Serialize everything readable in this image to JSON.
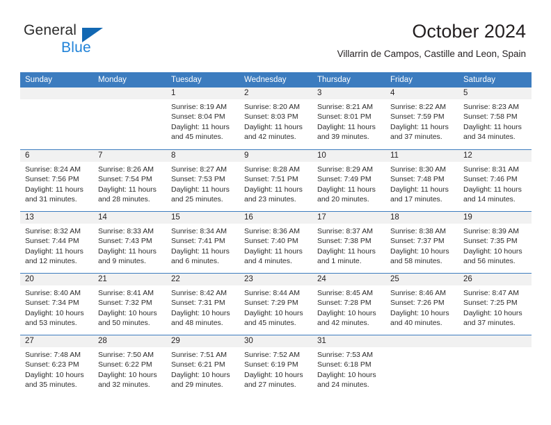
{
  "logo": {
    "word1": "General",
    "word2": "Blue",
    "triangle_color": "#1268b3",
    "blue_text_color": "#1f82d8"
  },
  "header": {
    "title": "October 2024",
    "location": "Villarrin de Campos, Castille and Leon, Spain"
  },
  "theme": {
    "header_band": "#3c7cbf",
    "day_number_band": "#f1f1f1",
    "text": "#231f20"
  },
  "weekdays": [
    "Sunday",
    "Monday",
    "Tuesday",
    "Wednesday",
    "Thursday",
    "Friday",
    "Saturday"
  ],
  "labels": {
    "sunrise_prefix": "Sunrise:",
    "sunset_prefix": "Sunset:",
    "daylight_prefix": "Daylight:"
  },
  "weeks": [
    [
      {
        "day": "",
        "sunrise": "",
        "sunset": "",
        "daylight": ""
      },
      {
        "day": "",
        "sunrise": "",
        "sunset": "",
        "daylight": ""
      },
      {
        "day": "1",
        "sunrise": "Sunrise: 8:19 AM",
        "sunset": "Sunset: 8:04 PM",
        "daylight": "Daylight: 11 hours and 45 minutes."
      },
      {
        "day": "2",
        "sunrise": "Sunrise: 8:20 AM",
        "sunset": "Sunset: 8:03 PM",
        "daylight": "Daylight: 11 hours and 42 minutes."
      },
      {
        "day": "3",
        "sunrise": "Sunrise: 8:21 AM",
        "sunset": "Sunset: 8:01 PM",
        "daylight": "Daylight: 11 hours and 39 minutes."
      },
      {
        "day": "4",
        "sunrise": "Sunrise: 8:22 AM",
        "sunset": "Sunset: 7:59 PM",
        "daylight": "Daylight: 11 hours and 37 minutes."
      },
      {
        "day": "5",
        "sunrise": "Sunrise: 8:23 AM",
        "sunset": "Sunset: 7:58 PM",
        "daylight": "Daylight: 11 hours and 34 minutes."
      }
    ],
    [
      {
        "day": "6",
        "sunrise": "Sunrise: 8:24 AM",
        "sunset": "Sunset: 7:56 PM",
        "daylight": "Daylight: 11 hours and 31 minutes."
      },
      {
        "day": "7",
        "sunrise": "Sunrise: 8:26 AM",
        "sunset": "Sunset: 7:54 PM",
        "daylight": "Daylight: 11 hours and 28 minutes."
      },
      {
        "day": "8",
        "sunrise": "Sunrise: 8:27 AM",
        "sunset": "Sunset: 7:53 PM",
        "daylight": "Daylight: 11 hours and 25 minutes."
      },
      {
        "day": "9",
        "sunrise": "Sunrise: 8:28 AM",
        "sunset": "Sunset: 7:51 PM",
        "daylight": "Daylight: 11 hours and 23 minutes."
      },
      {
        "day": "10",
        "sunrise": "Sunrise: 8:29 AM",
        "sunset": "Sunset: 7:49 PM",
        "daylight": "Daylight: 11 hours and 20 minutes."
      },
      {
        "day": "11",
        "sunrise": "Sunrise: 8:30 AM",
        "sunset": "Sunset: 7:48 PM",
        "daylight": "Daylight: 11 hours and 17 minutes."
      },
      {
        "day": "12",
        "sunrise": "Sunrise: 8:31 AM",
        "sunset": "Sunset: 7:46 PM",
        "daylight": "Daylight: 11 hours and 14 minutes."
      }
    ],
    [
      {
        "day": "13",
        "sunrise": "Sunrise: 8:32 AM",
        "sunset": "Sunset: 7:44 PM",
        "daylight": "Daylight: 11 hours and 12 minutes."
      },
      {
        "day": "14",
        "sunrise": "Sunrise: 8:33 AM",
        "sunset": "Sunset: 7:43 PM",
        "daylight": "Daylight: 11 hours and 9 minutes."
      },
      {
        "day": "15",
        "sunrise": "Sunrise: 8:34 AM",
        "sunset": "Sunset: 7:41 PM",
        "daylight": "Daylight: 11 hours and 6 minutes."
      },
      {
        "day": "16",
        "sunrise": "Sunrise: 8:36 AM",
        "sunset": "Sunset: 7:40 PM",
        "daylight": "Daylight: 11 hours and 4 minutes."
      },
      {
        "day": "17",
        "sunrise": "Sunrise: 8:37 AM",
        "sunset": "Sunset: 7:38 PM",
        "daylight": "Daylight: 11 hours and 1 minute."
      },
      {
        "day": "18",
        "sunrise": "Sunrise: 8:38 AM",
        "sunset": "Sunset: 7:37 PM",
        "daylight": "Daylight: 10 hours and 58 minutes."
      },
      {
        "day": "19",
        "sunrise": "Sunrise: 8:39 AM",
        "sunset": "Sunset: 7:35 PM",
        "daylight": "Daylight: 10 hours and 56 minutes."
      }
    ],
    [
      {
        "day": "20",
        "sunrise": "Sunrise: 8:40 AM",
        "sunset": "Sunset: 7:34 PM",
        "daylight": "Daylight: 10 hours and 53 minutes."
      },
      {
        "day": "21",
        "sunrise": "Sunrise: 8:41 AM",
        "sunset": "Sunset: 7:32 PM",
        "daylight": "Daylight: 10 hours and 50 minutes."
      },
      {
        "day": "22",
        "sunrise": "Sunrise: 8:42 AM",
        "sunset": "Sunset: 7:31 PM",
        "daylight": "Daylight: 10 hours and 48 minutes."
      },
      {
        "day": "23",
        "sunrise": "Sunrise: 8:44 AM",
        "sunset": "Sunset: 7:29 PM",
        "daylight": "Daylight: 10 hours and 45 minutes."
      },
      {
        "day": "24",
        "sunrise": "Sunrise: 8:45 AM",
        "sunset": "Sunset: 7:28 PM",
        "daylight": "Daylight: 10 hours and 42 minutes."
      },
      {
        "day": "25",
        "sunrise": "Sunrise: 8:46 AM",
        "sunset": "Sunset: 7:26 PM",
        "daylight": "Daylight: 10 hours and 40 minutes."
      },
      {
        "day": "26",
        "sunrise": "Sunrise: 8:47 AM",
        "sunset": "Sunset: 7:25 PM",
        "daylight": "Daylight: 10 hours and 37 minutes."
      }
    ],
    [
      {
        "day": "27",
        "sunrise": "Sunrise: 7:48 AM",
        "sunset": "Sunset: 6:23 PM",
        "daylight": "Daylight: 10 hours and 35 minutes."
      },
      {
        "day": "28",
        "sunrise": "Sunrise: 7:50 AM",
        "sunset": "Sunset: 6:22 PM",
        "daylight": "Daylight: 10 hours and 32 minutes."
      },
      {
        "day": "29",
        "sunrise": "Sunrise: 7:51 AM",
        "sunset": "Sunset: 6:21 PM",
        "daylight": "Daylight: 10 hours and 29 minutes."
      },
      {
        "day": "30",
        "sunrise": "Sunrise: 7:52 AM",
        "sunset": "Sunset: 6:19 PM",
        "daylight": "Daylight: 10 hours and 27 minutes."
      },
      {
        "day": "31",
        "sunrise": "Sunrise: 7:53 AM",
        "sunset": "Sunset: 6:18 PM",
        "daylight": "Daylight: 10 hours and 24 minutes."
      },
      {
        "day": "",
        "sunrise": "",
        "sunset": "",
        "daylight": ""
      },
      {
        "day": "",
        "sunrise": "",
        "sunset": "",
        "daylight": ""
      }
    ]
  ]
}
